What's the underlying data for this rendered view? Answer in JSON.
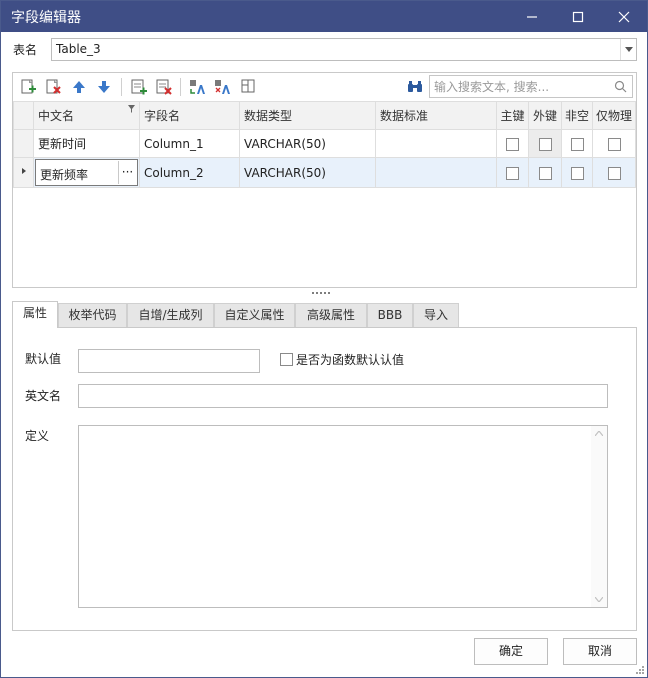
{
  "window": {
    "title": "字段编辑器"
  },
  "table_name": {
    "label": "表名",
    "value": "Table_3"
  },
  "toolbar": {
    "search_placeholder": "输入搜索文本, 搜索...",
    "icons": [
      "add-row-icon",
      "delete-row-icon",
      "move-up-icon",
      "move-down-icon",
      "add-column-icon",
      "delete-column-icon",
      "translate-icon",
      "translate-all-icon",
      "layout-icon",
      "binoculars-icon",
      "search-icon"
    ]
  },
  "grid": {
    "columns": [
      "中文名",
      "字段名",
      "数据类型",
      "数据标准",
      "主键",
      "外键",
      "非空",
      "仅物理"
    ],
    "rows": [
      {
        "cn": "更新时间",
        "field": "Column_1",
        "type": "VARCHAR(50)",
        "standard": ""
      },
      {
        "cn": "更新频率",
        "field": "Column_2",
        "type": "VARCHAR(50)",
        "standard": ""
      }
    ],
    "edit_button": "···"
  },
  "tabs": [
    {
      "label": "属性",
      "active": true
    },
    {
      "label": "枚举代码"
    },
    {
      "label": "自增/生成列"
    },
    {
      "label": "自定义属性"
    },
    {
      "label": "高级属性"
    },
    {
      "label": "BBB"
    },
    {
      "label": "导入"
    }
  ],
  "properties": {
    "default_label": "默认值",
    "default_value": "",
    "function_default_label": "是否为函数默认认值",
    "english_label": "英文名",
    "english_value": "",
    "definition_label": "定义",
    "definition_value": ""
  },
  "buttons": {
    "ok": "确定",
    "cancel": "取消"
  },
  "colors": {
    "titlebar": "#3f4e86",
    "selected_row": "#e8f1fb"
  }
}
